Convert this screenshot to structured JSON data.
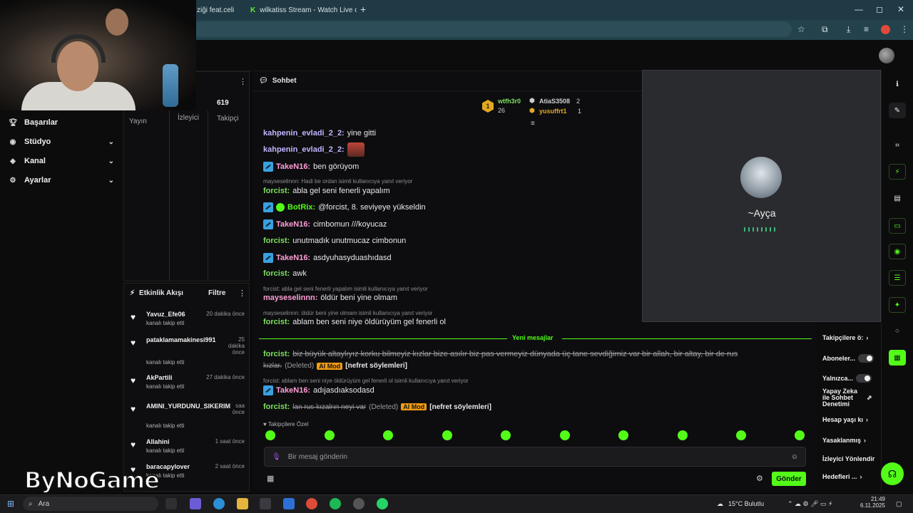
{
  "browser": {
    "tabs": [
      {
        "label": "ziği feat.celi"
      },
      {
        "label": "wilkatiss Stream - Watch Live o"
      }
    ],
    "new_tab": "+",
    "window_controls": [
      "—",
      "◻",
      "✕"
    ]
  },
  "left_nav": [
    {
      "icon": "trophy-icon",
      "label": "Başarılar"
    },
    {
      "icon": "studio-icon",
      "label": "Stüdyo"
    },
    {
      "icon": "channel-icon",
      "label": "Kanal"
    },
    {
      "icon": "gear-icon",
      "label": "Ayarlar"
    }
  ],
  "stats": {
    "yayin": "Yayın",
    "izleyici": "İzleyici",
    "takipci_label": "Takipçi",
    "takipci_value": "619"
  },
  "activity": {
    "title": "Etkinlik Akışı",
    "filter": "Filtre",
    "items": [
      {
        "name": "Yavuz_Efe06",
        "sub": "kanalı takip etti",
        "time": "20 dakika önce"
      },
      {
        "name": "pataklamamakinesi991",
        "sub": "kanalı takip etti",
        "time": "25 dakika önce"
      },
      {
        "name": "AkPartili",
        "sub": "kanalı takip etti",
        "time": "27 dakika önce"
      },
      {
        "name": "AMINI_YURDUNU_SIKERIM",
        "sub": "kanalı takip etti",
        "time": "saa önce"
      },
      {
        "name": "Allahini",
        "sub": "kanalı takip etti",
        "time": "1 saat önce"
      },
      {
        "name": "baracapylover",
        "sub": "kanalı takip etti",
        "time": "2 saat önce"
      }
    ]
  },
  "chat": {
    "title": "Sohbet",
    "leaders": {
      "first_name": "wtfh3r0",
      "first_count": "26",
      "first_rank": "1",
      "second_name": "AtiaS3508",
      "second_count": "2",
      "third_name": "yusuffrt1",
      "third_count": "1"
    },
    "messages": {
      "m1_user": "kahpenin_evladi_2_2:",
      "m1_text": "yine gitti",
      "m2_user": "kahpenin_evladi_2_2:",
      "m3_user": "TakeN16:",
      "m3_text": "ben görüyom",
      "r4": "mayseselinnn: Hadi be ordan isimli kullanıcıya yanıt veriyor",
      "m4_user": "forcist:",
      "m4_text": "abla gel seni fenerli yapalım",
      "m5_user": "BotRix:",
      "m5_text": "@forcist, 8. seviyeye yükseldin",
      "m6_user": "TakeN16:",
      "m6_text": "cimbomun ///koyucaz",
      "m7_user": "forcist:",
      "m7_text": "unutmadık unutmucaz cimbonun",
      "m8_user": "TakeN16:",
      "m8_text": "asdyuhasyduashıdasd",
      "m9_user": "forcist:",
      "m9_text": "awk",
      "r10": "forcist: abla gel seni fenerli yapalım isimli kullanıcıya yanıt veriyor",
      "m10_user": "mayseselinnn:",
      "m10_text": "öldür beni yine olmam",
      "r11": "mayseselinnn: öldür beni yine olmam isimli kullanıcıya yanıt veriyor",
      "m11_user": "forcist:",
      "m11_text": "ablam ben seni niye öldürüyüm gel fenerli ol"
    },
    "new_messages": "Yeni mesajlar",
    "new": {
      "n1_user": "forcist:",
      "n1_text": "biz büyük altaylıyız korku bilmeyiz kızlar bize asılır biz pas vermeyiz dünyada üç tane sevdiğimiz var bir allah, bir altay, bir de rus",
      "n1_cont": "kızlar.",
      "deleted": "(Deleted)",
      "ai_mod": "AI Mod",
      "hate": "[nefret söylemleri]",
      "r2": "forcist: ablam ben seni niye öldürüyüm gel fenerli ol isimli kullanıcıya yanıt veriyor",
      "n2_user": "TakeN16:",
      "n2_text": "adıjasdıaksodasd",
      "n3_user": "forcist:",
      "n3_text": "lan rus kızalrın neyi var"
    },
    "follower_only": "Takipçilere Özel",
    "input_placeholder": "Bir mesaj gönderin",
    "send": "Gönder"
  },
  "discord": {
    "name": "~Ayça"
  },
  "right_panel": [
    {
      "label": "Takipçilere ö:",
      "type": "chevron"
    },
    {
      "label": "Aboneler...",
      "type": "toggle"
    },
    {
      "label": "Yalnızca...",
      "type": "toggle"
    },
    {
      "label": "Yapay Zeka ile Sohbet Denetimi",
      "type": "external"
    },
    {
      "label": "Hesap yaşı kı",
      "type": "chevron"
    },
    {
      "label": "Yasaklanmış",
      "type": "chevron"
    },
    {
      "label": "İzleyici Yönlendir",
      "type": "none"
    },
    {
      "label": "Hedefleri ...",
      "type": "chevron"
    }
  ],
  "watermark": "ByNoGame",
  "taskbar": {
    "search": "Ara",
    "weather": "15°C  Bulutlu",
    "time": "21:49",
    "date": "6.11.2025"
  },
  "colors": {
    "accent": "#53fc18",
    "ai_mod": "#f39c12"
  }
}
